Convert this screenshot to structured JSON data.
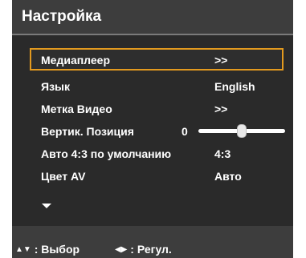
{
  "menu": {
    "title": "Настройка",
    "items": [
      {
        "label": "Медиаплеер",
        "value": ">>",
        "selected": true
      },
      {
        "label": "Язык",
        "value": "English"
      },
      {
        "label": "Метка Видео",
        "value": ">>"
      },
      {
        "label": "Вертик. Позиция",
        "value": "0",
        "slider_level": 0.5
      },
      {
        "label": "Авто 4:3 по умолчанию",
        "value": "4:3"
      },
      {
        "label": "Цвет AV",
        "value": "Авто"
      }
    ]
  },
  "footer": {
    "select_label": ": Выбор",
    "adjust_label": ": Регул."
  },
  "icons": {
    "more": "chevron-down-icon",
    "select": "up-down-arrows-icon",
    "adjust": "left-right-arrows-icon"
  },
  "colors": {
    "selection_border": "#e39a1f",
    "panel": "#2a2a2a",
    "header": "#3d3d3d"
  }
}
